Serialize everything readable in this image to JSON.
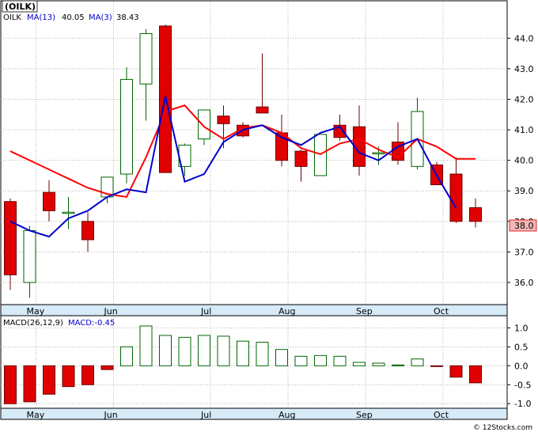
{
  "header": {
    "ticker": "(OILK)",
    "legend_ticker": "OILK",
    "ma13_label": "MA(13)",
    "ma13_value": "40.05",
    "ma3_label": "MA(3)",
    "ma3_value": "38.43",
    "macd_label": "MACD(26,12,9)",
    "macd_value_label": "MACD:-0.45"
  },
  "footer": {
    "watermark": "© 12Stocks.com"
  },
  "colors": {
    "up": "#006400",
    "down": "#e00000",
    "ma13": "#ff0000",
    "ma3": "#0000cc",
    "axis_band": "#d6eaf8",
    "last_price_bg": "#f4b6b6"
  },
  "chart_data": {
    "type": "candlestick",
    "price_axis": {
      "ylim": [
        35.3,
        45.2
      ],
      "ticks": [
        "36.0",
        "37.0",
        "38.0",
        "39.0",
        "40.0",
        "41.0",
        "42.0",
        "43.0",
        "44.0"
      ]
    },
    "macd_axis": {
      "ylim": [
        -1.1,
        1.3
      ],
      "ticks": [
        "-1.0",
        "-0.5",
        "0.0",
        "0.5",
        "1.0"
      ]
    },
    "x_labels": [
      {
        "label": "May",
        "index": 1
      },
      {
        "label": "Jun",
        "index": 5
      },
      {
        "label": "Jul",
        "index": 10
      },
      {
        "label": "Aug",
        "index": 14
      },
      {
        "label": "Sep",
        "index": 18
      },
      {
        "label": "Oct",
        "index": 22
      }
    ],
    "last_price": "38.0",
    "candles": [
      {
        "o": 38.65,
        "h": 38.75,
        "l": 35.75,
        "c": 36.25
      },
      {
        "o": 36.0,
        "h": 37.85,
        "l": 35.5,
        "c": 37.7
      },
      {
        "o": 38.95,
        "h": 39.35,
        "l": 38.0,
        "c": 38.35
      },
      {
        "o": 38.3,
        "h": 38.8,
        "l": 37.75,
        "c": 38.3
      },
      {
        "o": 38.0,
        "h": 38.3,
        "l": 37.0,
        "c": 37.4
      },
      {
        "o": 38.8,
        "h": 39.45,
        "l": 38.6,
        "c": 39.45
      },
      {
        "o": 39.55,
        "h": 43.05,
        "l": 39.25,
        "c": 42.65
      },
      {
        "o": 42.5,
        "h": 44.3,
        "l": 41.3,
        "c": 44.15
      },
      {
        "o": 44.4,
        "h": 44.45,
        "l": 39.6,
        "c": 39.6
      },
      {
        "o": 39.8,
        "h": 40.55,
        "l": 39.5,
        "c": 40.5
      },
      {
        "o": 40.7,
        "h": 41.65,
        "l": 40.5,
        "c": 41.65
      },
      {
        "o": 41.45,
        "h": 41.8,
        "l": 40.4,
        "c": 41.2
      },
      {
        "o": 41.15,
        "h": 41.25,
        "l": 40.75,
        "c": 40.8
      },
      {
        "o": 41.75,
        "h": 43.5,
        "l": 41.55,
        "c": 41.55
      },
      {
        "o": 40.9,
        "h": 41.5,
        "l": 39.8,
        "c": 40.0
      },
      {
        "o": 40.3,
        "h": 40.35,
        "l": 39.3,
        "c": 39.8
      },
      {
        "o": 39.5,
        "h": 40.85,
        "l": 39.5,
        "c": 40.85
      },
      {
        "o": 41.15,
        "h": 41.5,
        "l": 40.65,
        "c": 40.75
      },
      {
        "o": 41.1,
        "h": 41.8,
        "l": 39.5,
        "c": 39.8
      },
      {
        "o": 40.25,
        "h": 40.45,
        "l": 39.85,
        "c": 40.25
      },
      {
        "o": 40.6,
        "h": 41.25,
        "l": 39.85,
        "c": 40.0
      },
      {
        "o": 39.8,
        "h": 42.05,
        "l": 39.7,
        "c": 41.6
      },
      {
        "o": 39.85,
        "h": 39.95,
        "l": 39.25,
        "c": 39.2
      },
      {
        "o": 39.55,
        "h": 40.1,
        "l": 37.95,
        "c": 38.0
      },
      {
        "o": 38.45,
        "h": 38.75,
        "l": 37.8,
        "c": 38.0
      }
    ],
    "series": [
      {
        "name": "MA(13)",
        "values": [
          40.3,
          40.0,
          39.7,
          39.4,
          39.1,
          38.9,
          38.8,
          null,
          null,
          null,
          null,
          41.2,
          41.1,
          40.8,
          40.5,
          40.2,
          40.0,
          40.2,
          40.5,
          40.6,
          40.6,
          40.5,
          40.3,
          40.05,
          40.05
        ]
      },
      {
        "name": "MA(3)",
        "values": [
          38.0,
          37.5,
          38.1,
          38.0,
          38.35,
          39.2,
          42.0,
          42.1,
          null,
          null,
          null,
          null,
          null,
          null,
          null,
          null,
          null,
          null,
          null,
          null,
          null,
          null,
          null,
          null,
          38.43
        ]
      },
      {
        "name": "MACD histogram",
        "values": [
          -1.0,
          -0.95,
          -0.75,
          -0.55,
          -0.5,
          -0.1,
          0.5,
          1.05,
          0.8,
          0.75,
          0.8,
          0.78,
          0.65,
          0.62,
          0.43,
          0.25,
          0.27,
          0.25,
          0.09,
          0.07,
          0.02,
          0.18,
          -0.02,
          -0.3,
          -0.45
        ]
      }
    ],
    "ma13_line": [
      40.3,
      40.0,
      39.7,
      39.4,
      39.1,
      38.9,
      38.8,
      40.1,
      41.6,
      41.8,
      41.1,
      40.7,
      41.05,
      41.15,
      40.9,
      40.4,
      40.2,
      40.55,
      40.7,
      40.35,
      40.1,
      40.7,
      40.45,
      40.05,
      40.05
    ],
    "ma3_line": [
      38.0,
      37.7,
      37.5,
      38.1,
      38.35,
      38.8,
      39.05,
      38.95,
      42.1,
      39.3,
      39.55,
      40.6,
      41.0,
      41.15,
      40.75,
      40.5,
      40.9,
      41.1,
      40.25,
      40.0,
      40.45,
      40.7,
      39.5,
      38.43,
      38.43
    ]
  }
}
